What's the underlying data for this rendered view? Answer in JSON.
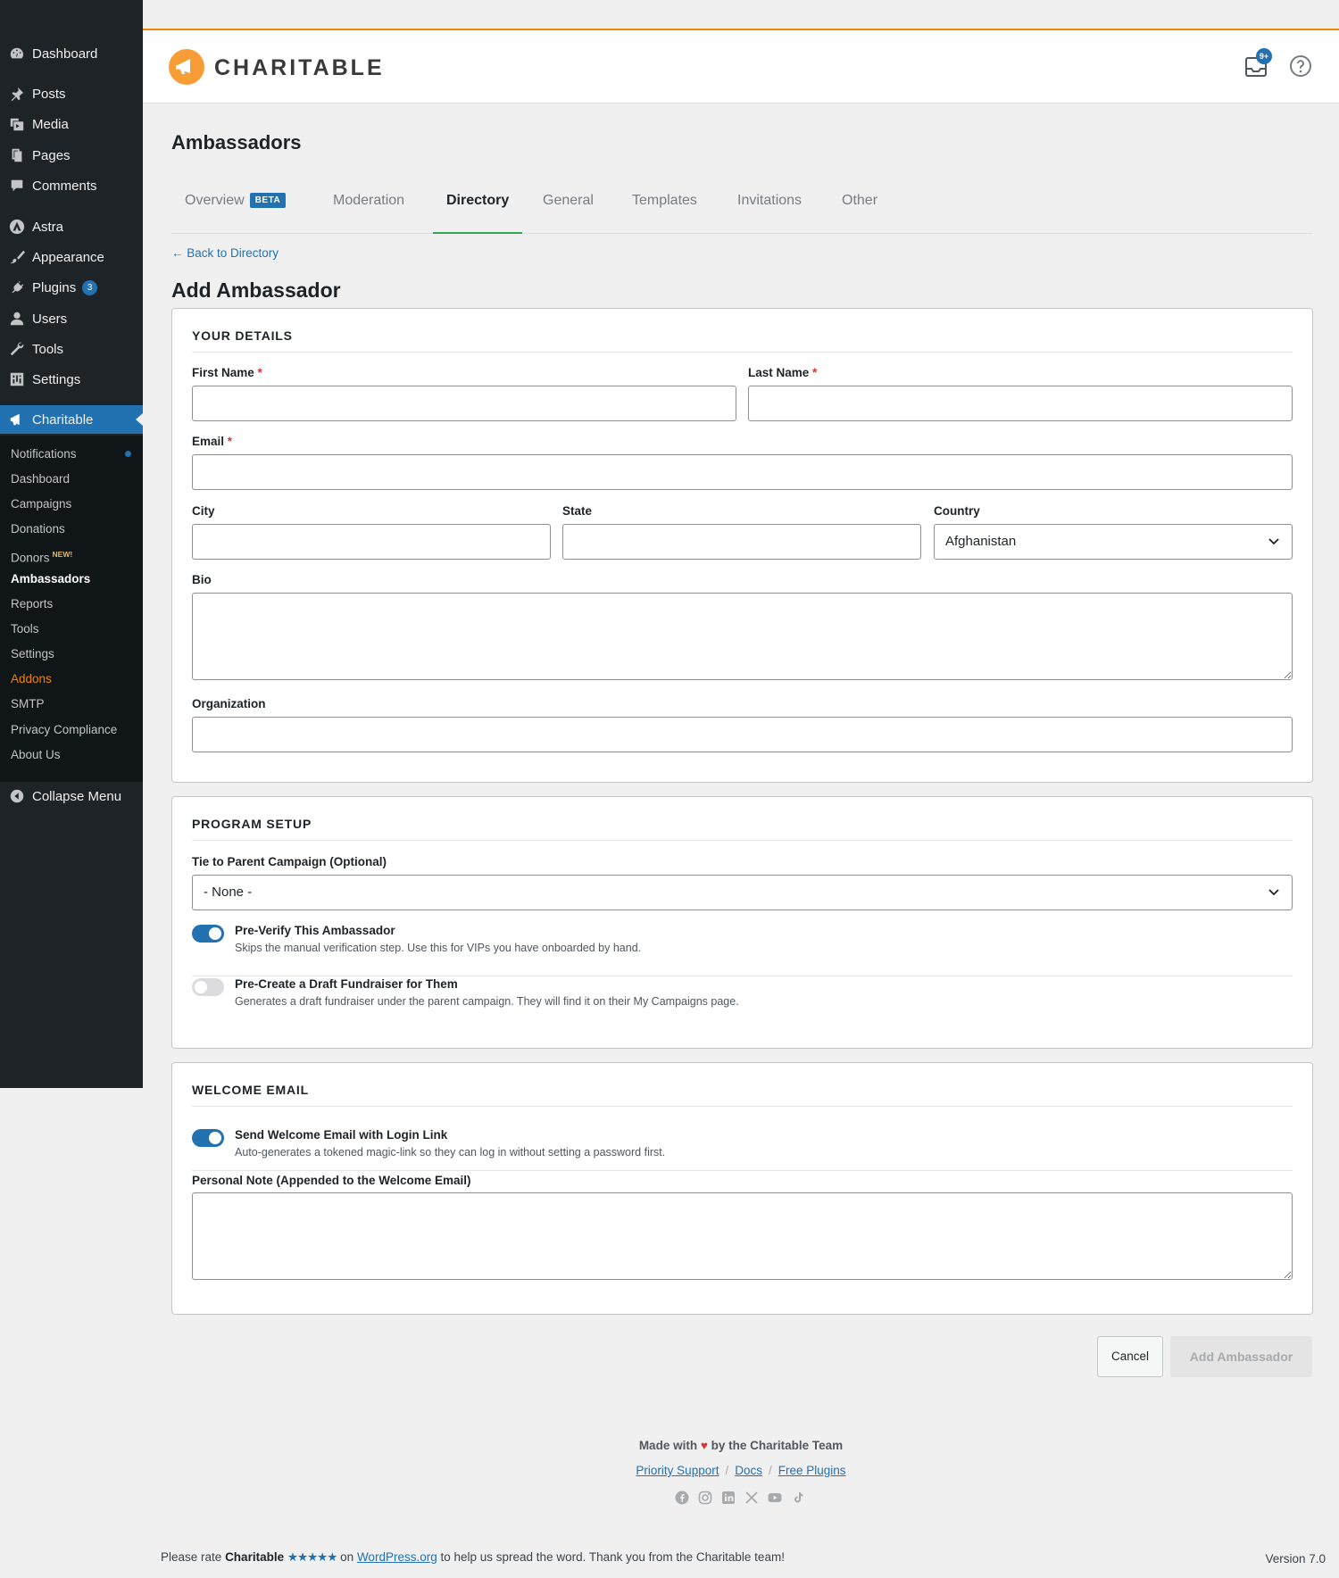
{
  "sidebar": {
    "items": [
      {
        "label": "Dashboard",
        "icon": "dashboard-icon"
      },
      {
        "label": "Posts",
        "icon": "pin-icon"
      },
      {
        "label": "Media",
        "icon": "media-icon"
      },
      {
        "label": "Pages",
        "icon": "pages-icon"
      },
      {
        "label": "Comments",
        "icon": "comments-icon"
      },
      {
        "label": "Astra",
        "icon": "astra-icon"
      },
      {
        "label": "Appearance",
        "icon": "brush-icon"
      },
      {
        "label": "Plugins",
        "icon": "plug-icon",
        "badge": "3"
      },
      {
        "label": "Users",
        "icon": "user-icon"
      },
      {
        "label": "Tools",
        "icon": "wrench-icon"
      },
      {
        "label": "Settings",
        "icon": "settings-icon"
      },
      {
        "label": "Charitable",
        "icon": "megaphone-icon"
      }
    ],
    "submenu": [
      "Notifications",
      "Dashboard",
      "Campaigns",
      "Donations",
      "Donors",
      "Ambassadors",
      "Reports",
      "Tools",
      "Settings",
      "Addons",
      "SMTP",
      "Privacy Compliance",
      "About Us"
    ],
    "new_tag": "NEW!",
    "collapse": "Collapse Menu"
  },
  "header": {
    "logo_text": "CHARITABLE",
    "inbox_badge": "9+"
  },
  "page": {
    "title": "Ambassadors",
    "tabs": [
      "Overview",
      "Moderation",
      "Directory",
      "General",
      "Templates",
      "Invitations",
      "Other"
    ],
    "beta": "BETA",
    "back_link": "← Back to Directory",
    "form_title": "Add Ambassador"
  },
  "details": {
    "title": "YOUR DETAILS",
    "first_name": "First Name",
    "last_name": "Last Name",
    "email": "Email",
    "city": "City",
    "state": "State",
    "country": "Country",
    "country_value": "Afghanistan",
    "bio": "Bio",
    "organization": "Organization",
    "required": "*"
  },
  "program": {
    "title": "PROGRAM SETUP",
    "parent_label": "Tie to Parent Campaign (Optional)",
    "parent_value": "- None -",
    "verify_title": "Pre-Verify This Ambassador",
    "verify_desc": "Skips the manual verification step. Use this for VIPs you have onboarded by hand.",
    "draft_title": "Pre-Create a Draft Fundraiser for Them",
    "draft_desc": "Generates a draft fundraiser under the parent campaign. They will find it on their My Campaigns page."
  },
  "welcome": {
    "title": "WELCOME EMAIL",
    "send_title": "Send Welcome Email with Login Link",
    "send_desc": "Auto-generates a tokened magic-link so they can log in without setting a password first.",
    "note_label": "Personal Note (Appended to the Welcome Email)"
  },
  "actions": {
    "cancel": "Cancel",
    "add": "Add Ambassador"
  },
  "footer": {
    "made_with_1": "Made with",
    "made_with_2": "by the Charitable Team",
    "links": [
      "Priority Support",
      "Docs",
      "Free Plugins"
    ],
    "rate_1": "Please rate",
    "rate_brand": "Charitable",
    "rate_stars": "★★★★★",
    "rate_2": "on",
    "rate_link": "WordPress.org",
    "rate_3": "to help us spread the word. Thank you from the Charitable team!",
    "version": "Version 7.0"
  },
  "colors": {
    "accent": "#2271b1",
    "brand": "#f89d35",
    "sidebar_bg": "#1d2327"
  }
}
